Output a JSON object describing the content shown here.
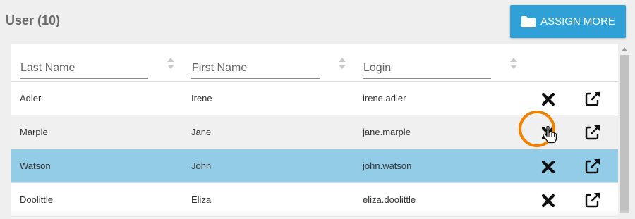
{
  "header": {
    "title": "User (10)",
    "assign_label": "ASSIGN MORE",
    "assign_icon": "folder-icon"
  },
  "table": {
    "columns": [
      {
        "label": "Last Name",
        "sortable": true
      },
      {
        "label": "First Name",
        "sortable": true
      },
      {
        "label": "Login",
        "sortable": true
      }
    ],
    "rows": [
      {
        "last": "Adler",
        "first": "Irene",
        "login": "irene.adler",
        "selected": false
      },
      {
        "last": "Marple",
        "first": "Jane",
        "login": "jane.marple",
        "selected": false
      },
      {
        "last": "Watson",
        "first": "John",
        "login": "john.watson",
        "selected": true
      },
      {
        "last": "Doolittle",
        "first": "Eliza",
        "login": "eliza.doolittle",
        "selected": false
      }
    ],
    "row_actions": [
      "close-icon",
      "external-link-icon"
    ]
  },
  "colors": {
    "accent": "#2fa1d6",
    "selected_row": "#92cce6",
    "highlight_ring": "#ef8200"
  }
}
